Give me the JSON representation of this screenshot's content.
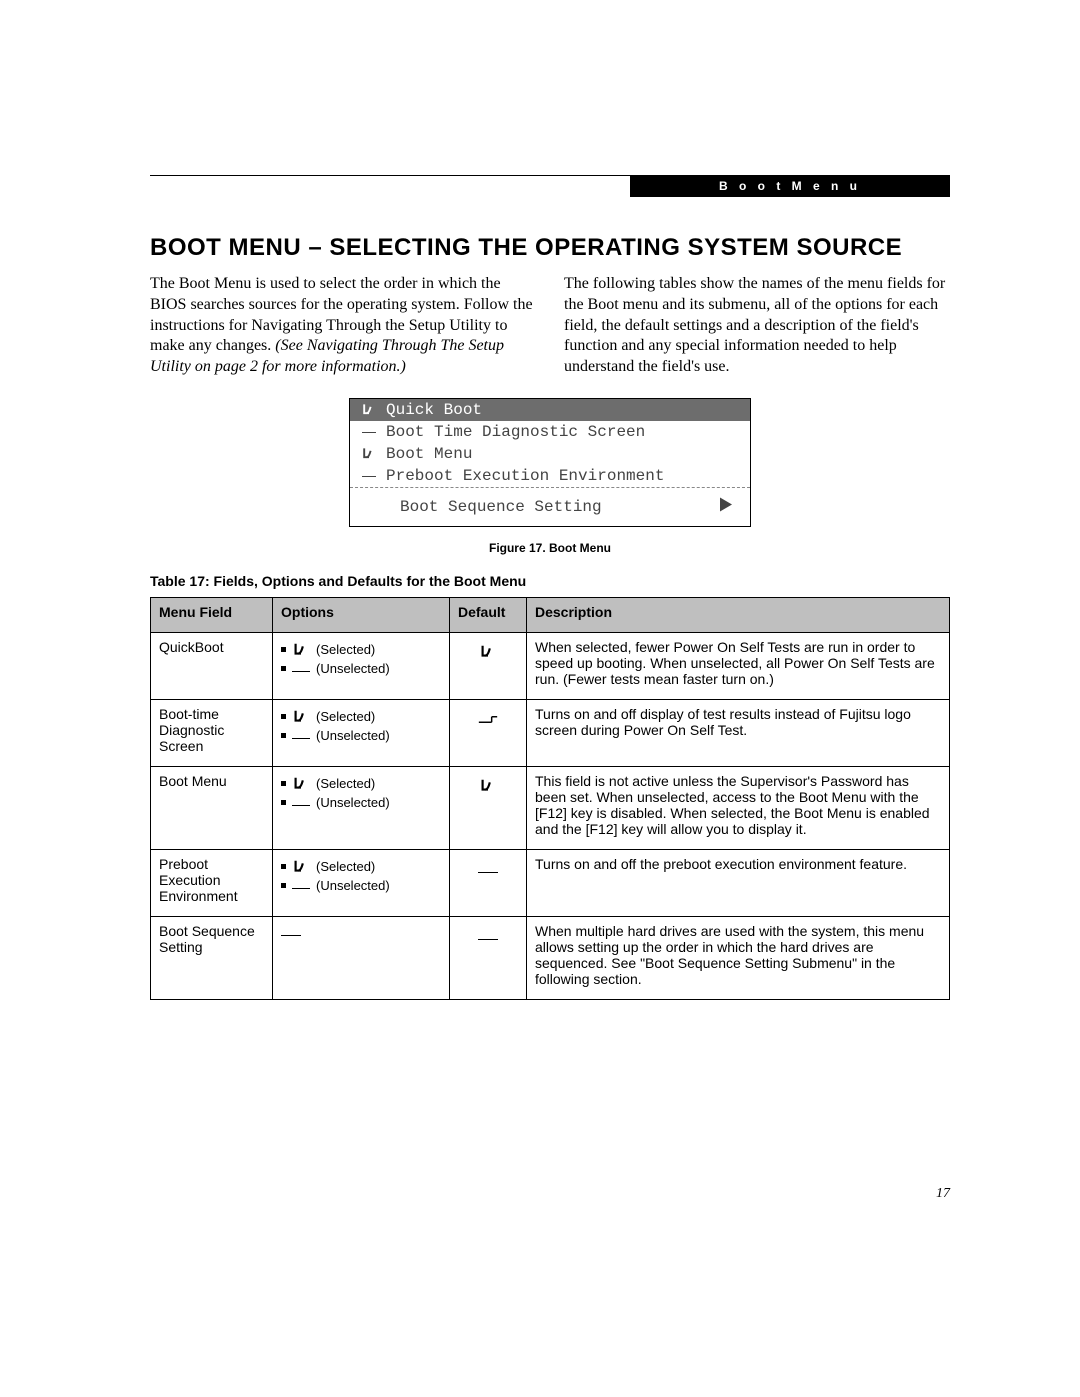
{
  "header_tab": "B o o t   M e n u",
  "title": "BOOT MENU – SELECTING THE OPERATING SYSTEM SOURCE",
  "intro_left": "The Boot Menu is used to select the order in which the BIOS searches sources for the operating system. Follow the instructions for Navigating Through the Setup Utility to make any changes. ",
  "intro_left_italic": "(See Navigating Through The Setup Utility on page 2 for more information.)",
  "intro_right": "The following tables show the names of the menu fields for the Boot menu and its submenu, all of the options for each field, the default settings and a description of the field's function and any special information needed to help understand the field's use.",
  "bios_items": [
    {
      "mark": "check",
      "label": "Quick Boot",
      "selected": true
    },
    {
      "mark": "dash",
      "label": "Boot Time Diagnostic Screen",
      "selected": false
    },
    {
      "mark": "check",
      "label": "Boot Menu",
      "selected": false
    },
    {
      "mark": "dash",
      "label": "Preboot Execution Environment",
      "selected": false
    }
  ],
  "bios_sub_label": "Boot Sequence Setting",
  "fig_caption": "Figure 17.  Boot Menu",
  "table_caption": "Table 17: Fields, Options and Defaults for the Boot Menu",
  "table_headers": [
    "Menu Field",
    "Options",
    "Default",
    "Description"
  ],
  "option_labels": {
    "selected": "(Selected)",
    "unselected": "(Unselected)"
  },
  "rows": [
    {
      "field": "QuickBoot",
      "options": "both",
      "default": "check",
      "desc": "When selected, fewer Power On Self Tests are run in order to speed up booting. When unselected, all Power On Self Tests are run. (Fewer tests mean faster turn on.)"
    },
    {
      "field": "Boot-time Diagnostic Screen",
      "options": "both",
      "default": "unselected",
      "desc": "Turns on and off display of test results instead of Fujitsu logo screen during Power On Self Test."
    },
    {
      "field": "Boot Menu",
      "options": "both",
      "default": "check",
      "desc": "This field is not active unless the Supervisor's Password has been set. When unselected, access to the Boot Menu with the [F12] key is disabled. When selected, the Boot Menu is enabled and the [F12] key will allow you to display it."
    },
    {
      "field": "Preboot Execution Environment",
      "options": "both",
      "default": "dash",
      "desc": "Turns on and off the preboot execution environment feature."
    },
    {
      "field": "Boot Sequence Setting",
      "options": "dash",
      "default": "dash",
      "desc": "When multiple hard drives are used with the system, this menu allows setting up the order in which the hard drives are sequenced. See \"Boot Sequence Setting Submenu\" in the following section."
    }
  ],
  "page_number": "17"
}
